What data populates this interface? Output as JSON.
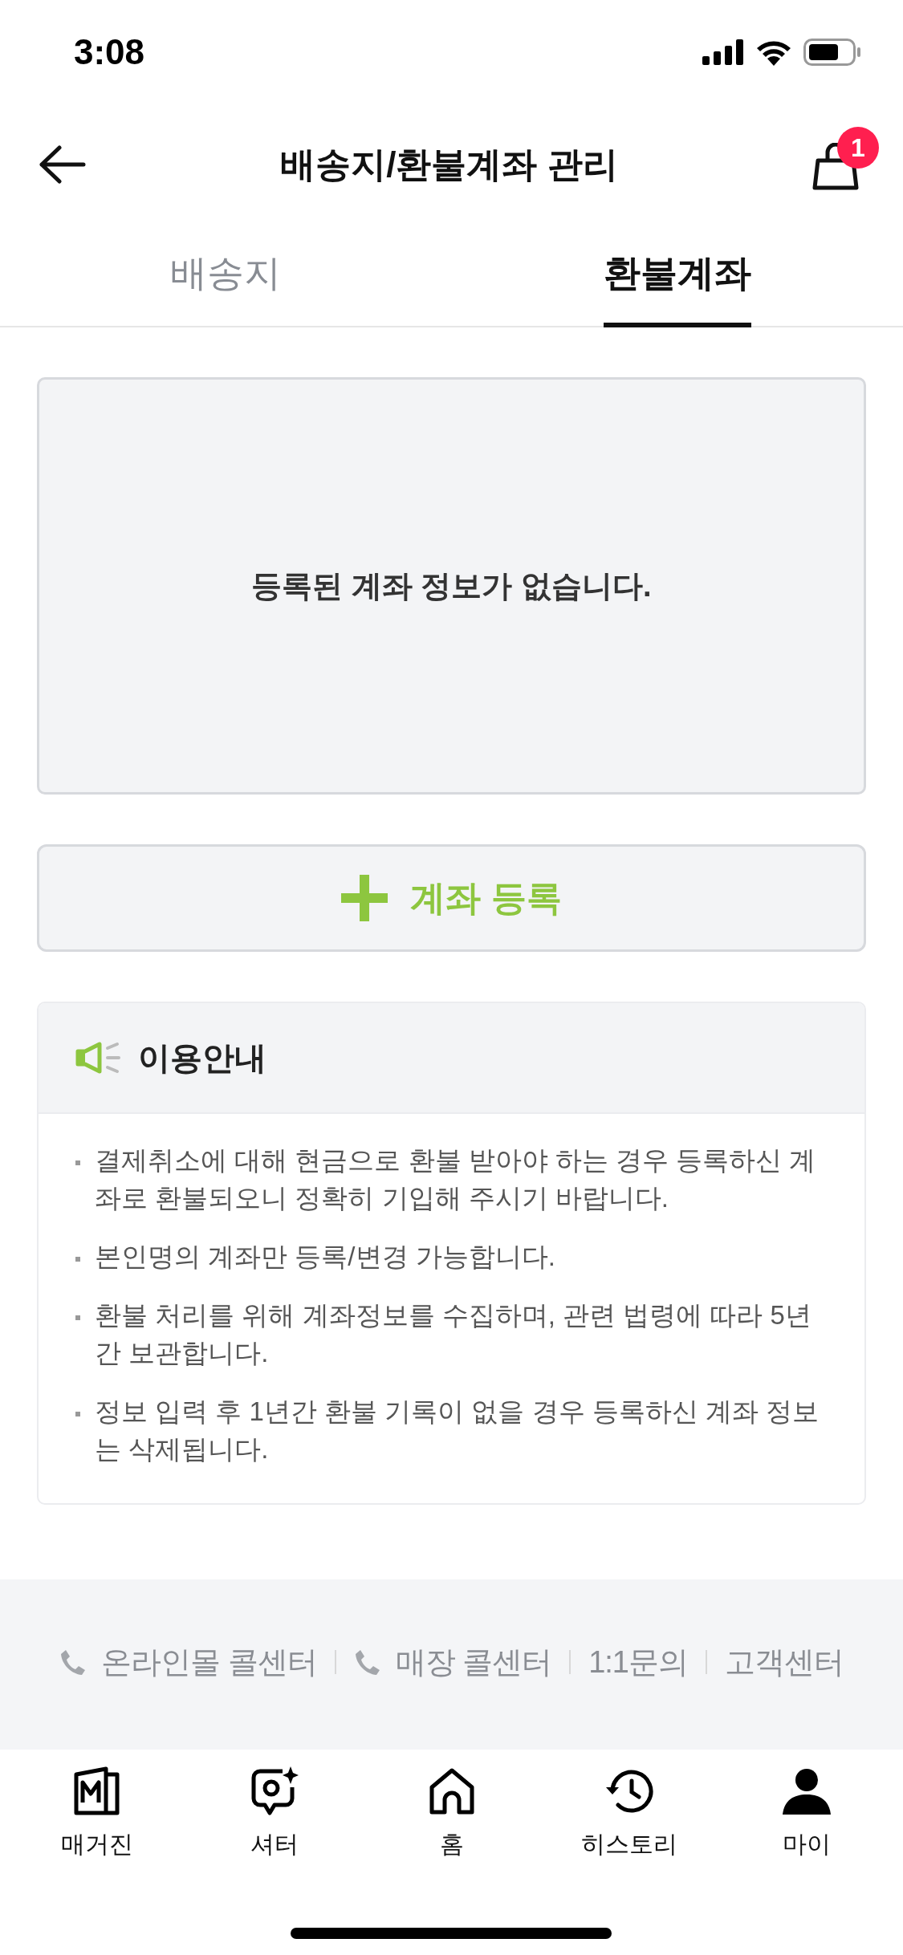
{
  "status_bar": {
    "time": "3:08"
  },
  "header": {
    "title": "배송지/환불계좌 관리",
    "cart_badge": "1"
  },
  "tabs": [
    {
      "label": "배송지",
      "selected": false
    },
    {
      "label": "환불계좌",
      "selected": true
    }
  ],
  "empty_message": "등록된 계좌 정보가 없습니다.",
  "register_button": {
    "label": "계좌 등록"
  },
  "notice": {
    "title": "이용안내",
    "items": [
      "결제취소에 대해 현금으로 환불 받아야 하는 경우 등록하신 계좌로 환불되오니 정확히 기입해 주시기 바랍니다.",
      "본인명의 계좌만 등록/변경 가능합니다.",
      "환불 처리를 위해 계좌정보를 수집하며, 관련 법령에 따라 5년간 보관합니다.",
      "정보 입력 후 1년간 환불 기록이 없을 경우 등록하신 계좌 정보는 삭제됩니다."
    ]
  },
  "footer": {
    "links": [
      {
        "label": "온라인몰 콜센터",
        "kind": "phone"
      },
      {
        "label": "매장 콜센터",
        "kind": "phone"
      },
      {
        "label": "1:1문의",
        "kind": "plain"
      },
      {
        "label": "고객센터",
        "kind": "plain"
      }
    ]
  },
  "bottom_nav": [
    {
      "label": "매거진",
      "kind": "magazine"
    },
    {
      "label": "셔터",
      "kind": "shutter"
    },
    {
      "label": "홈",
      "kind": "home"
    },
    {
      "label": "히스토리",
      "kind": "history"
    },
    {
      "label": "마이",
      "kind": "my"
    }
  ]
}
